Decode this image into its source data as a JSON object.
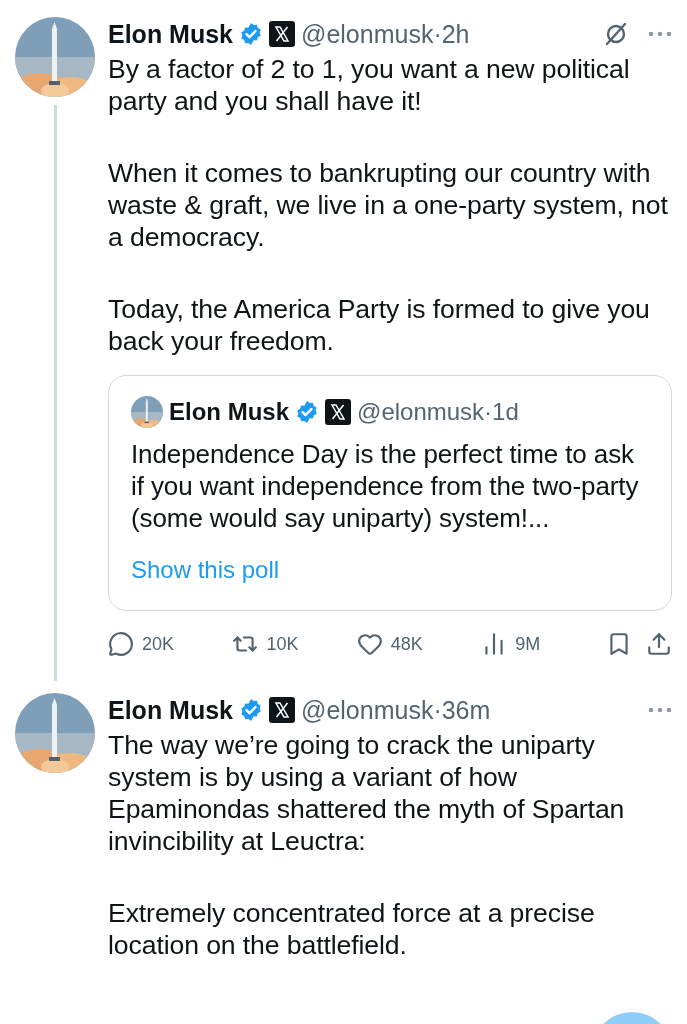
{
  "tweets": [
    {
      "author": {
        "name": "Elon Musk",
        "verified": true,
        "handle": "@elonmusk",
        "separator": "·",
        "time": "2h"
      },
      "thread_continues": true,
      "grok_icon": true,
      "paragraphs": [
        "By a factor of 2 to 1, you want a new political party and you shall have it!",
        "When it comes to bankrupting our country with waste & graft, we live in a one-party system, not a democracy.",
        "Today, the America Party is formed to give you back your freedom."
      ],
      "quote": {
        "author": {
          "name": "Elon Musk",
          "verified": true,
          "handle": "@elonmusk",
          "separator": "·",
          "time": "1d"
        },
        "text": "Independence Day is the perfect time to ask if you want independence from the two-party (some would say uniparty) system!...",
        "link": "Show this poll"
      },
      "actions": [
        {
          "kind": "reply",
          "count": "20K"
        },
        {
          "kind": "repost",
          "count": "10K"
        },
        {
          "kind": "like",
          "count": "48K"
        },
        {
          "kind": "views",
          "count": "9M"
        },
        {
          "kind": "bookmark"
        },
        {
          "kind": "share"
        }
      ]
    },
    {
      "author": {
        "name": "Elon Musk",
        "verified": true,
        "handle": "@elonmusk",
        "separator": "·",
        "time": "36m"
      },
      "thread_continues": false,
      "grok_icon": false,
      "paragraphs": [
        "The way we’re going to crack the uniparty system is by using a variant of how Epaminondas shattered the myth of Spartan invincibility at Leuctra:",
        "Extremely concentrated force at a precise location on the battlefield."
      ]
    }
  ]
}
